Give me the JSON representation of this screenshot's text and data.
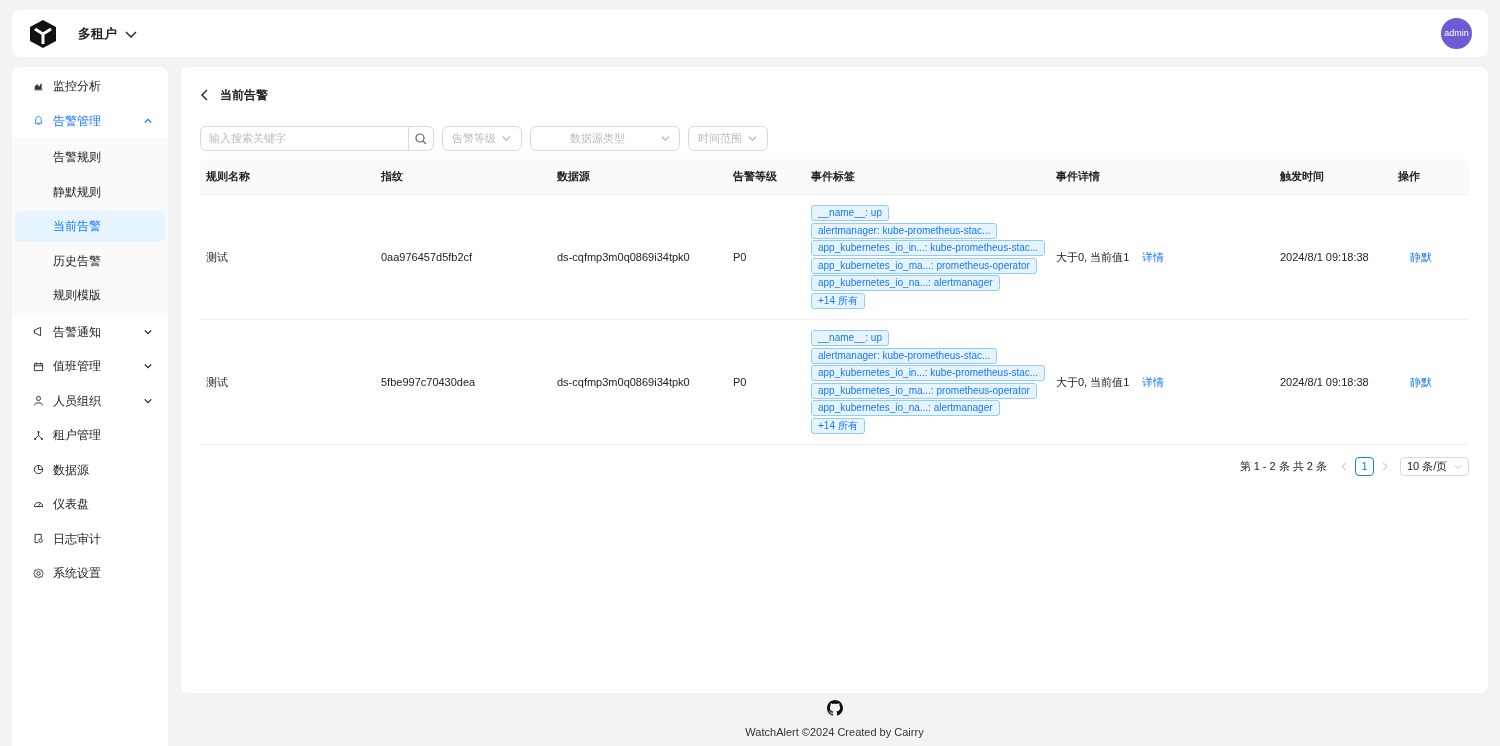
{
  "header": {
    "tenant": "多租户",
    "user": "admin"
  },
  "sidebar": {
    "items": [
      {
        "label": "监控分析",
        "selected": false
      },
      {
        "label": "告警管理",
        "selected": true,
        "expanded": true,
        "children": [
          {
            "label": "告警规则",
            "selected": false
          },
          {
            "label": "静默规则",
            "selected": false
          },
          {
            "label": "当前告警",
            "selected": true
          },
          {
            "label": "历史告警",
            "selected": false
          },
          {
            "label": "规则模版",
            "selected": false
          }
        ]
      },
      {
        "label": "告警通知",
        "selected": false,
        "expanded": false
      },
      {
        "label": "值班管理",
        "selected": false,
        "expanded": false
      },
      {
        "label": "人员组织",
        "selected": false,
        "expanded": false
      },
      {
        "label": "租户管理",
        "selected": false
      },
      {
        "label": "数据源",
        "selected": false
      },
      {
        "label": "仪表盘",
        "selected": false
      },
      {
        "label": "日志审计",
        "selected": false
      },
      {
        "label": "系统设置",
        "selected": false
      }
    ]
  },
  "page": {
    "title": "当前告警"
  },
  "filters": {
    "search": {
      "placeholder": "输入搜索关键字"
    },
    "selects": [
      {
        "placeholder": "告警等级",
        "kind": "left"
      },
      {
        "placeholder": "数据源类型",
        "kind": "center"
      },
      {
        "placeholder": "时间范围",
        "kind": "left"
      }
    ]
  },
  "table": {
    "columns": [
      "规则名称",
      "指纹",
      "数据源",
      "告警等级",
      "事件标签",
      "事件详情",
      "触发时间",
      "操作"
    ],
    "rows": [
      {
        "name": "测试",
        "fingerprint": "0aa976457d5fb2cf",
        "datasource": "ds-cqfmp3m0q0869i34tpk0",
        "severity": "P0",
        "tags": [
          "__name__: up",
          "alertmanager: kube-prometheus-stac...",
          "app_kubernetes_io_in...: kube-prometheus-stac...",
          "app_kubernetes_io_ma...: prometheus-operator",
          "app_kubernetes_io_na...: alertmanager",
          "+14 所有"
        ],
        "detail": "大于0, 当前值1",
        "detail_link": "详情",
        "time": "2024/8/1 09:18:38",
        "action": "静默"
      },
      {
        "name": "测试",
        "fingerprint": "5fbe997c70430dea",
        "datasource": "ds-cqfmp3m0q0869i34tpk0",
        "severity": "P0",
        "tags": [
          "__name__: up",
          "alertmanager: kube-prometheus-stac...",
          "app_kubernetes_io_in...: kube-prometheus-stac...",
          "app_kubernetes_io_ma...: prometheus-operator",
          "app_kubernetes_io_na...: alertmanager",
          "+14 所有"
        ],
        "detail": "大于0, 当前值1",
        "detail_link": "详情",
        "time": "2024/8/1 09:18:38",
        "action": "静默"
      }
    ]
  },
  "pagination": {
    "summary": "第 1 - 2 条 共 2 条",
    "pages": [
      {
        "label": "1",
        "selected": true
      }
    ],
    "page_size": "10 条/页"
  },
  "footer": {
    "text": "WatchAlert ©2024 Created by Cairry"
  }
}
